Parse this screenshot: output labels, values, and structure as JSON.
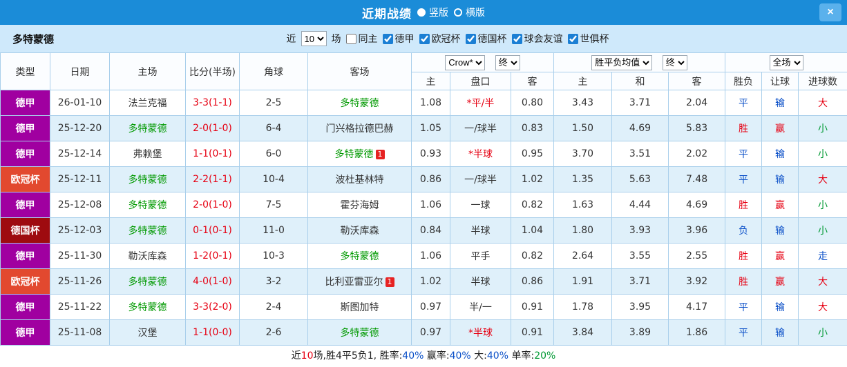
{
  "titlebar": {
    "title": "近期战绩",
    "close_glyph": "×",
    "layout_options": [
      {
        "label": "竖版",
        "selected": true
      },
      {
        "label": "横版",
        "selected": false
      }
    ]
  },
  "filterbar": {
    "team": "多特蒙德",
    "recent_prefix": "近",
    "recent_count": "10",
    "recent_suffix": "场",
    "checkboxes": [
      {
        "label": "同主",
        "checked": false
      },
      {
        "label": "德甲",
        "checked": true
      },
      {
        "label": "欧冠杯",
        "checked": true
      },
      {
        "label": "德国杯",
        "checked": true
      },
      {
        "label": "球会友谊",
        "checked": true
      },
      {
        "label": "世俱杯",
        "checked": true
      }
    ]
  },
  "controls": {
    "company": "Crow*",
    "company_time": "终",
    "europe": "胜平负均值",
    "europe_time": "终",
    "scope": "全场"
  },
  "table": {
    "headers": {
      "type": "类型",
      "date": "日期",
      "home": "主场",
      "score": "比分(半场)",
      "corners": "角球",
      "away": "客场"
    },
    "subheaders": {
      "odds_home": "主",
      "handicap": "盘口",
      "odds_away": "客",
      "win": "主",
      "draw": "和",
      "lose": "客",
      "result": "胜负",
      "spread": "让球",
      "goals": "进球数"
    }
  },
  "colors": {
    "titlebar_blue": "#1b8cd8",
    "filterbar_blue": "#cfe9fb",
    "row_alt_blue": "#dff0fa",
    "grid_line": "#a9cfeb",
    "league_dejia": "#a000a0",
    "league_ouguanbei": "#e2492f",
    "league_deguobei": "#9e0b0f",
    "text_red": "#e60012",
    "text_blue": "#0b50c8",
    "text_green": "#009933",
    "focus_team_green": "#009900"
  },
  "rows": [
    {
      "league": "德甲",
      "league_bg": "#a000a0",
      "date": "26-01-10",
      "home": "法兰克福",
      "home_card": "",
      "score": "3-3(1-1)",
      "corners": "2-5",
      "away": "多特蒙德",
      "away_card": "",
      "odds_home": "1.08",
      "handicap": "*平/半",
      "odds_away": "0.80",
      "win": "3.43",
      "draw": "3.71",
      "lose": "2.04",
      "result": "平",
      "spread": "输",
      "goals": "大"
    },
    {
      "league": "德甲",
      "league_bg": "#a000a0",
      "date": "25-12-20",
      "home": "多特蒙德",
      "home_card": "",
      "score": "2-0(1-0)",
      "corners": "6-4",
      "away": "门兴格拉德巴赫",
      "away_card": "",
      "odds_home": "1.05",
      "handicap": "一/球半",
      "odds_away": "0.83",
      "win": "1.50",
      "draw": "4.69",
      "lose": "5.83",
      "result": "胜",
      "spread": "赢",
      "goals": "小"
    },
    {
      "league": "德甲",
      "league_bg": "#a000a0",
      "date": "25-12-14",
      "home": "弗赖堡",
      "home_card": "",
      "score": "1-1(0-1)",
      "corners": "6-0",
      "away": "多特蒙德",
      "away_card": "1",
      "odds_home": "0.93",
      "handicap": "*半球",
      "odds_away": "0.95",
      "win": "3.70",
      "draw": "3.51",
      "lose": "2.02",
      "result": "平",
      "spread": "输",
      "goals": "小"
    },
    {
      "league": "欧冠杯",
      "league_bg": "#e2492f",
      "date": "25-12-11",
      "home": "多特蒙德",
      "home_card": "",
      "score": "2-2(1-1)",
      "corners": "10-4",
      "away": "波杜基林特",
      "away_card": "",
      "odds_home": "0.86",
      "handicap": "一/球半",
      "odds_away": "1.02",
      "win": "1.35",
      "draw": "5.63",
      "lose": "7.48",
      "result": "平",
      "spread": "输",
      "goals": "大"
    },
    {
      "league": "德甲",
      "league_bg": "#a000a0",
      "date": "25-12-08",
      "home": "多特蒙德",
      "home_card": "",
      "score": "2-0(1-0)",
      "corners": "7-5",
      "away": "霍芬海姆",
      "away_card": "",
      "odds_home": "1.06",
      "handicap": "一球",
      "odds_away": "0.82",
      "win": "1.63",
      "draw": "4.44",
      "lose": "4.69",
      "result": "胜",
      "spread": "赢",
      "goals": "小"
    },
    {
      "league": "德国杯",
      "league_bg": "#9e0b0f",
      "date": "25-12-03",
      "home": "多特蒙德",
      "home_card": "",
      "score": "0-1(0-1)",
      "corners": "11-0",
      "away": "勒沃库森",
      "away_card": "",
      "odds_home": "0.84",
      "handicap": "半球",
      "odds_away": "1.04",
      "win": "1.80",
      "draw": "3.93",
      "lose": "3.96",
      "result": "负",
      "spread": "输",
      "goals": "小"
    },
    {
      "league": "德甲",
      "league_bg": "#a000a0",
      "date": "25-11-30",
      "home": "勒沃库森",
      "home_card": "",
      "score": "1-2(0-1)",
      "corners": "10-3",
      "away": "多特蒙德",
      "away_card": "",
      "odds_home": "1.06",
      "handicap": "平手",
      "odds_away": "0.82",
      "win": "2.64",
      "draw": "3.55",
      "lose": "2.55",
      "result": "胜",
      "spread": "赢",
      "goals": "走"
    },
    {
      "league": "欧冠杯",
      "league_bg": "#e2492f",
      "date": "25-11-26",
      "home": "多特蒙德",
      "home_card": "",
      "score": "4-0(1-0)",
      "corners": "3-2",
      "away": "比利亚雷亚尔",
      "away_card": "1",
      "odds_home": "1.02",
      "handicap": "半球",
      "odds_away": "0.86",
      "win": "1.91",
      "draw": "3.71",
      "lose": "3.92",
      "result": "胜",
      "spread": "赢",
      "goals": "大"
    },
    {
      "league": "德甲",
      "league_bg": "#a000a0",
      "date": "25-11-22",
      "home": "多特蒙德",
      "home_card": "",
      "score": "3-3(2-0)",
      "corners": "2-4",
      "away": "斯图加特",
      "away_card": "",
      "odds_home": "0.97",
      "handicap": "半/一",
      "odds_away": "0.91",
      "win": "1.78",
      "draw": "3.95",
      "lose": "4.17",
      "result": "平",
      "spread": "输",
      "goals": "大"
    },
    {
      "league": "德甲",
      "league_bg": "#a000a0",
      "date": "25-11-08",
      "home": "汉堡",
      "home_card": "",
      "score": "1-1(0-0)",
      "corners": "2-6",
      "away": "多特蒙德",
      "away_card": "",
      "odds_home": "0.97",
      "handicap": "*半球",
      "odds_away": "0.91",
      "win": "3.84",
      "draw": "3.89",
      "lose": "1.86",
      "result": "平",
      "spread": "输",
      "goals": "小"
    }
  ],
  "footer": {
    "segments": [
      {
        "text": "近",
        "color": ""
      },
      {
        "text": "10",
        "color": "red"
      },
      {
        "text": "场,胜4平5负1, 胜率:",
        "color": ""
      },
      {
        "text": "40%",
        "color": "blue"
      },
      {
        "text": " 赢率:",
        "color": ""
      },
      {
        "text": "40%",
        "color": "blue"
      },
      {
        "text": " 大:",
        "color": ""
      },
      {
        "text": "40%",
        "color": "blue"
      },
      {
        "text": " 单率:",
        "color": ""
      },
      {
        "text": "20%",
        "color": "green"
      }
    ]
  }
}
